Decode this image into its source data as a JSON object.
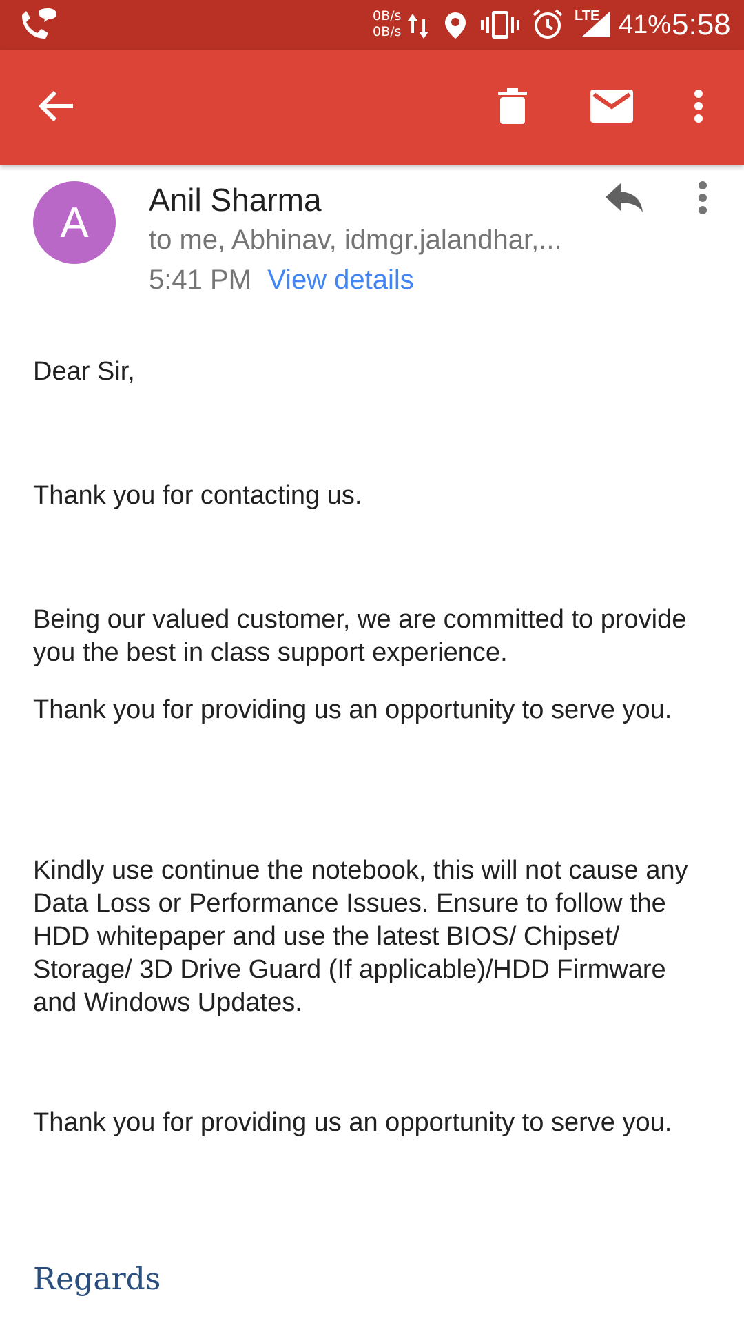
{
  "status_bar": {
    "net_speed_up": "0B/s",
    "net_speed_down": "0B/s",
    "network_type": "LTE",
    "battery": "41%",
    "time": "5:58",
    "icons": [
      "wifi-calling-icon",
      "data-transfer-icon",
      "location-icon",
      "vibrate-icon",
      "alarm-icon",
      "signal-icon"
    ]
  },
  "app_bar": {
    "back_icon": "arrow-back-icon",
    "delete_icon": "delete-icon",
    "mark_unread_icon": "mail-icon",
    "more_icon": "more-vert-icon",
    "color": "#db4437"
  },
  "email": {
    "avatar_letter": "A",
    "avatar_color": "#ba68c8",
    "sender": "Anil Sharma",
    "recipients": "to me, Abhinav, idmgr.jalandhar,...",
    "time": "5:41 PM",
    "view_details": "View details",
    "reply_icon": "reply-icon",
    "more_icon": "more-vert-icon",
    "body": {
      "greeting": "Dear Sir,",
      "p1": "Thank you for contacting us.",
      "p2": "Being our valued customer, we are committed to provide you the best in class support experience.",
      "p3": "Thank you for providing us an opportunity to serve you.",
      "p4": "Kindly use continue the notebook, this will not cause any Data Loss or Performance Issues. Ensure to follow the HDD whitepaper and use the latest BIOS/ Chipset/ Storage/ 3D Drive Guard (If applicable)/HDD Firmware and Windows Updates.",
      "p5": "Thank you for providing us an opportunity to serve you.",
      "regards": "Regards"
    }
  }
}
